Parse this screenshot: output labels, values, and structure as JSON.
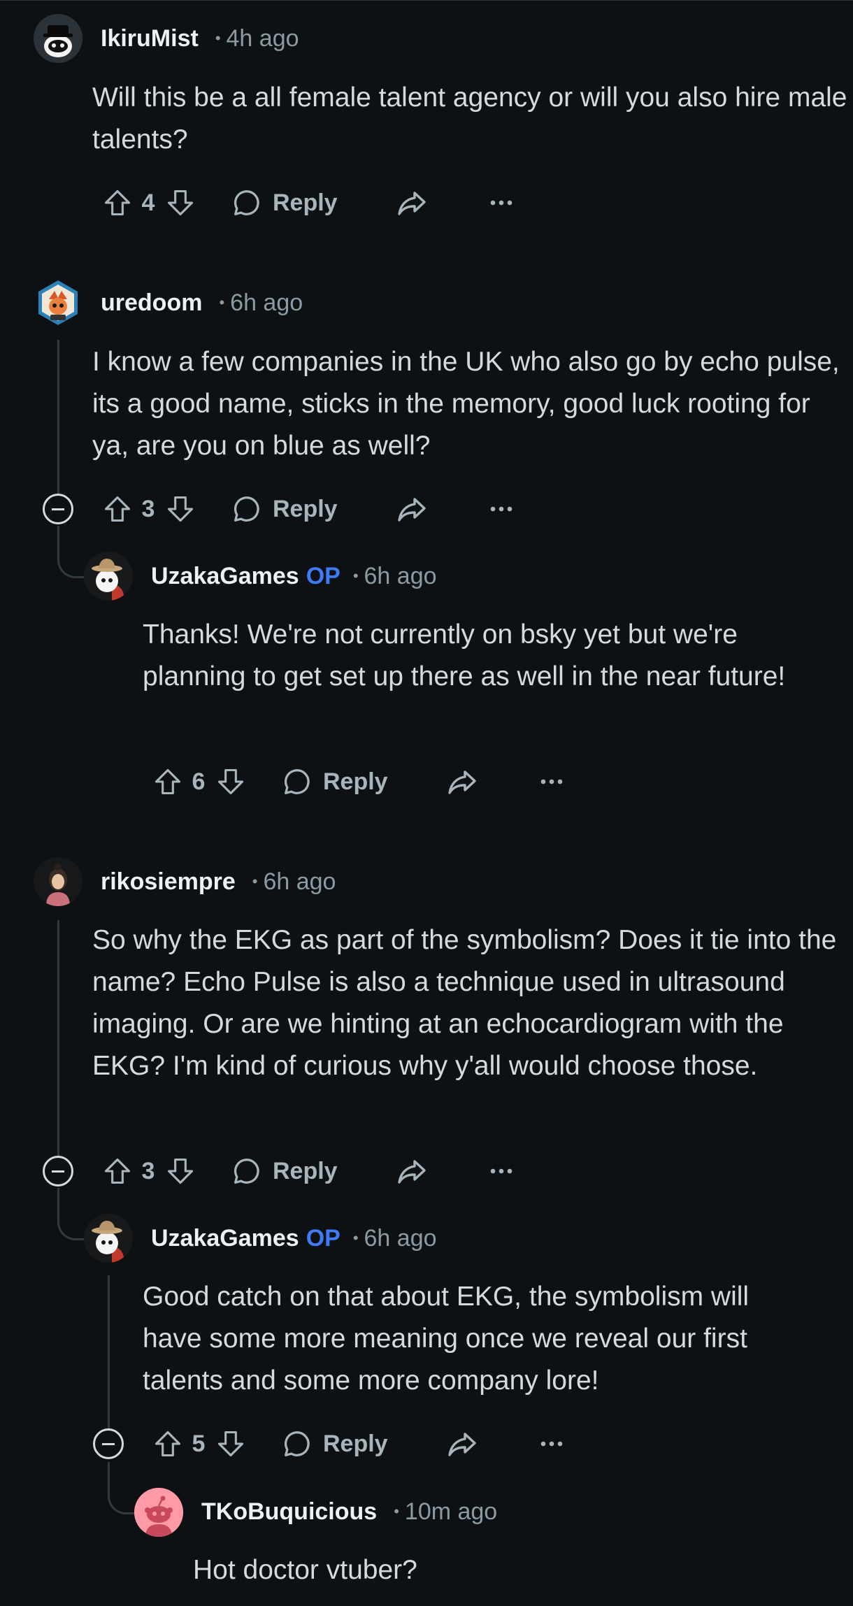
{
  "comments": [
    {
      "username": "IkiruMist",
      "time": "4h ago",
      "op": "",
      "body": "Will this be a all female talent agency or will you also hire male talents?",
      "votes": "4",
      "reply_label": "Reply",
      "avatar_icon": "snoo-avatar-hat-icon"
    },
    {
      "username": "uredoom",
      "time": "6h ago",
      "op": "",
      "body": "I know a few companies in the UK who also go by echo pulse, its a good name, sticks in the memory, good luck rooting for ya, are you on blue as well?",
      "votes": "3",
      "reply_label": "Reply",
      "avatar_icon": "hexagon-avatar-icon"
    },
    {
      "username": "UzakaGames",
      "time": "6h ago",
      "op": "OP",
      "body": "Thanks! We're not currently on bsky yet but we're planning to get set up there as well in the near future!",
      "votes": "6",
      "reply_label": "Reply",
      "avatar_icon": "cowboy-snoo-avatar-icon"
    },
    {
      "username": "rikosiempre",
      "time": "6h ago",
      "op": "",
      "body": "So why the EKG as part of the symbolism? Does it tie into the name? Echo Pulse is also a technique used in ultrasound imaging. Or are we hinting at an echocardiogram with the EKG? I'm kind of curious why y'all would choose those.",
      "votes": "3",
      "reply_label": "Reply",
      "avatar_icon": "portrait-avatar-icon"
    },
    {
      "username": "UzakaGames",
      "time": "6h ago",
      "op": "OP",
      "body": "Good catch on that about EKG, the symbolism will have some more meaning once we reveal our first talents and some more company lore!",
      "votes": "5",
      "reply_label": "Reply",
      "avatar_icon": "cowboy-snoo-avatar-icon"
    },
    {
      "username": "TKoBuquicious",
      "time": "10m ago",
      "op": "",
      "body": "Hot doctor vtuber?",
      "votes": "",
      "reply_label": "",
      "avatar_icon": "default-snoo-avatar-icon"
    }
  ],
  "colors": {
    "background": "#0e1113",
    "op_badge": "#3e7bf7",
    "meta_text": "#8b9aa3",
    "action_icons": "#a9b5bc",
    "thread_line": "#2f3a40"
  }
}
